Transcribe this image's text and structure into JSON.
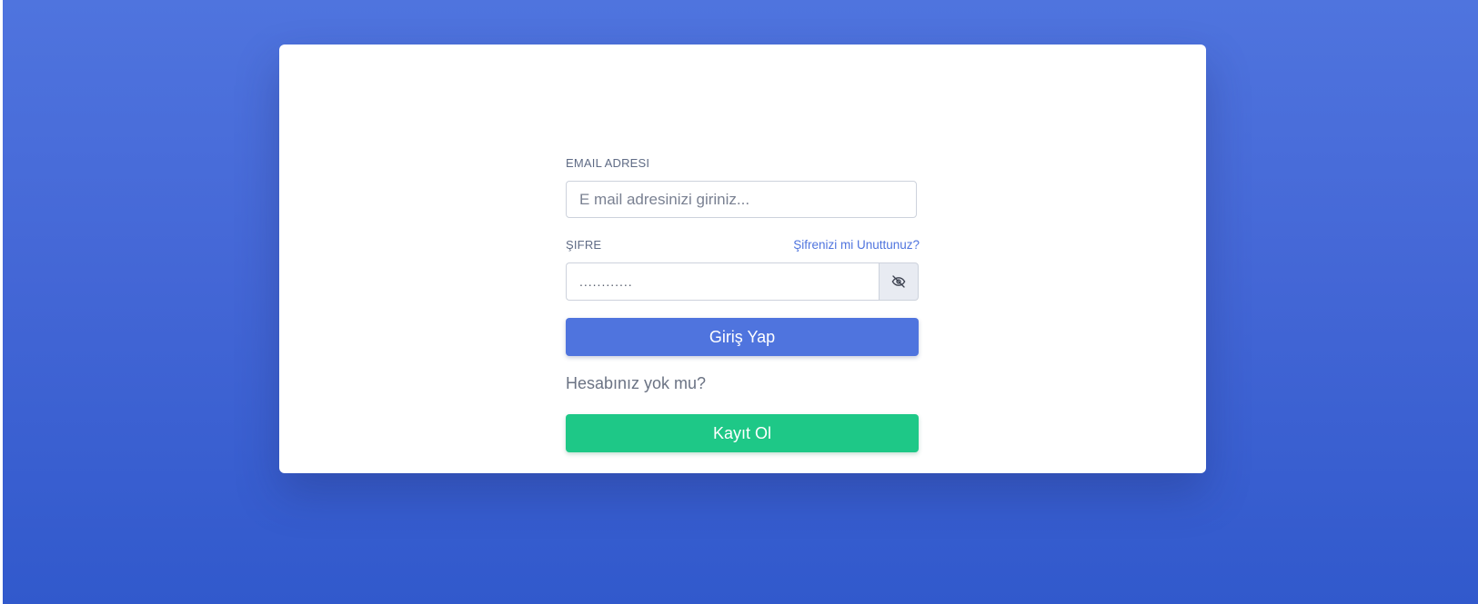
{
  "login_form": {
    "email_label": "EMAIL ADRESI",
    "email_placeholder": "E mail adresinizi giriniz...",
    "password_label": "ŞIFRE",
    "forgot_password_link": "Şifrenizi mi Unuttunuz?",
    "password_value": "............",
    "toggle_visibility_icon": "eye-off-icon",
    "login_button": "Giriş Yap",
    "no_account_text": "Hesabınız yok mu?",
    "register_button": "Kayıt Ol"
  },
  "colors": {
    "background_top": "#4f74de",
    "background_bottom": "#3159cc",
    "primary": "#4f74de",
    "success": "#1ec887",
    "card": "#ffffff"
  }
}
